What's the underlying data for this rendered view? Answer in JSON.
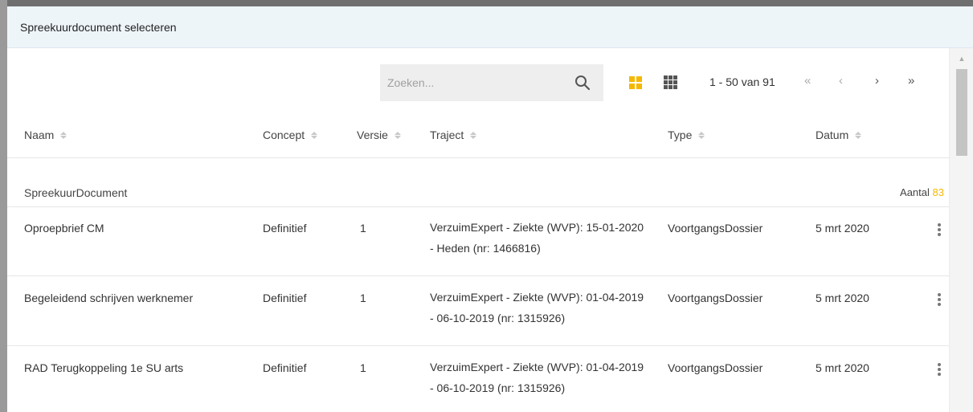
{
  "dialog": {
    "title": "Spreekuurdocument selecteren"
  },
  "toolbar": {
    "search_placeholder": "Zoeken...",
    "search_icon": "search-icon",
    "view_tiles_icon": "tiles-view-icon",
    "view_grid_icon": "grid-view-icon",
    "pager_info": "1 - 50 van 91",
    "first_label": "«",
    "prev_label": "‹",
    "next_label": "›",
    "last_label": "»"
  },
  "columns": [
    "Naam",
    "Concept",
    "Versie",
    "Traject",
    "Type",
    "Datum"
  ],
  "group": {
    "label": "SpreekuurDocument",
    "count_label": "Aantal",
    "count_value": "83"
  },
  "rows": [
    {
      "naam": "Oproepbrief CM",
      "concept": "Definitief",
      "versie": "1",
      "traject": "VerzuimExpert - Ziekte (WVP): 15-01-2020 - Heden (nr: 1466816)",
      "type": "VoortgangsDossier",
      "datum": "5 mrt 2020"
    },
    {
      "naam": "Begeleidend schrijven werknemer",
      "concept": "Definitief",
      "versie": "1",
      "traject": "VerzuimExpert - Ziekte (WVP): 01-04-2019 - 06-10-2019 (nr: 1315926)",
      "type": "VoortgangsDossier",
      "datum": "5 mrt 2020"
    },
    {
      "naam": "RAD Terugkoppeling 1e SU arts",
      "concept": "Definitief",
      "versie": "1",
      "traject": "VerzuimExpert - Ziekte (WVP): 01-04-2019 - 06-10-2019 (nr: 1315926)",
      "type": "VoortgangsDossier",
      "datum": "5 mrt 2020"
    }
  ],
  "colors": {
    "accent": "#f5b800",
    "header_bg": "#eef5f9"
  }
}
